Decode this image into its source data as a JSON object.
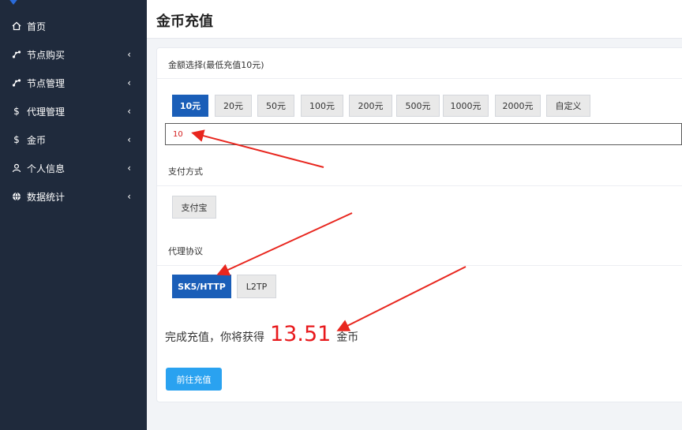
{
  "sidebar": {
    "items": [
      {
        "label": "首页",
        "icon": "home-icon"
      },
      {
        "label": "节点购买",
        "icon": "node-icon"
      },
      {
        "label": "节点管理",
        "icon": "node-icon"
      },
      {
        "label": "代理管理",
        "icon": "dollar-icon"
      },
      {
        "label": "金币",
        "icon": "dollar-icon"
      },
      {
        "label": "个人信息",
        "icon": "user-icon"
      },
      {
        "label": "数据统计",
        "icon": "globe-icon"
      }
    ],
    "chevron": "‹"
  },
  "header": {
    "title": "金币充值"
  },
  "amount": {
    "label": "金额选择(最低充值10元)",
    "options": [
      "10元",
      "20元",
      "50元",
      "100元",
      "200元",
      "500元",
      "1000元",
      "2000元",
      "自定义"
    ],
    "selected_index": 0,
    "input_value": "10"
  },
  "payment": {
    "label": "支付方式",
    "options": [
      "支付宝"
    ]
  },
  "protocol": {
    "label": "代理协议",
    "options": [
      "SK5/HTTP",
      "L2TP"
    ],
    "selected_index": 0
  },
  "result": {
    "prefix": "完成充值，你将获得",
    "value": "13.51",
    "suffix": "金币"
  },
  "submit_label": "前往充值",
  "colors": {
    "sidebar_bg": "#1f2a3c",
    "selected_blue": "#1a5eb8",
    "submit_blue": "#2aa2f0",
    "highlight_red": "#e8191c",
    "arrow_red": "#e8261e"
  }
}
